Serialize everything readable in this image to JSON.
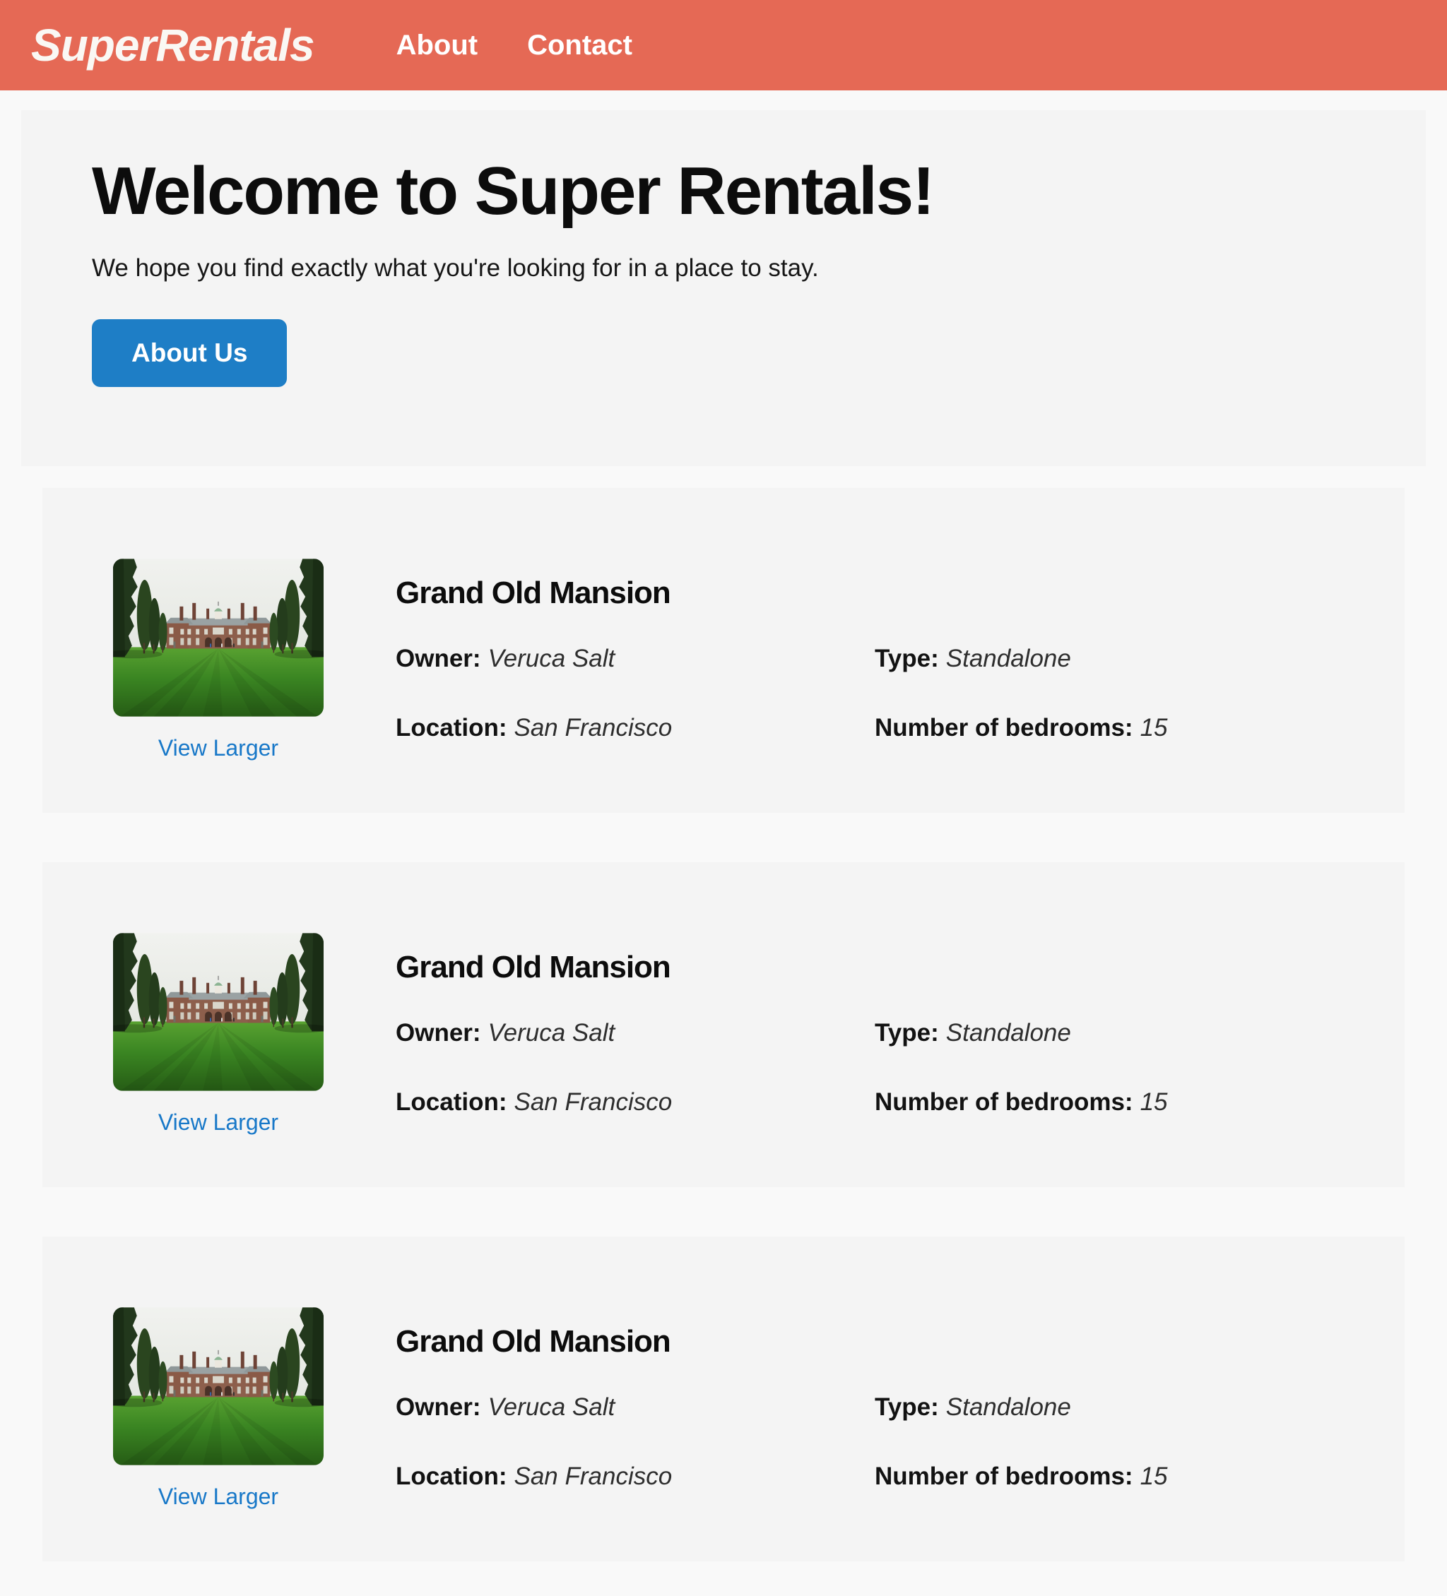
{
  "colors": {
    "navbar_bg": "#e56955",
    "button_bg": "#1e7ec6",
    "link_blue": "#1878c8",
    "section_bg": "#f4f4f4",
    "page_bg": "#f9f9f9"
  },
  "nav": {
    "brand": "SuperRentals",
    "links": [
      {
        "label": "About"
      },
      {
        "label": "Contact"
      }
    ]
  },
  "hero": {
    "title": "Welcome to Super Rentals!",
    "subtitle": "We hope you find exactly what you're looking for in a place to stay.",
    "button_label": "About Us"
  },
  "listings": [
    {
      "title": "Grand Old Mansion",
      "view_larger": "View Larger",
      "image_name": "grand-old-mansion-photo",
      "fields": {
        "owner_label": "Owner:",
        "owner": "Veruca Salt",
        "type_label": "Type:",
        "type": "Standalone",
        "location_label": "Location:",
        "location": "San Francisco",
        "bedrooms_label": "Number of bedrooms:",
        "bedrooms": "15"
      }
    },
    {
      "title": "Grand Old Mansion",
      "view_larger": "View Larger",
      "image_name": "grand-old-mansion-photo",
      "fields": {
        "owner_label": "Owner:",
        "owner": "Veruca Salt",
        "type_label": "Type:",
        "type": "Standalone",
        "location_label": "Location:",
        "location": "San Francisco",
        "bedrooms_label": "Number of bedrooms:",
        "bedrooms": "15"
      }
    },
    {
      "title": "Grand Old Mansion",
      "view_larger": "View Larger",
      "image_name": "grand-old-mansion-photo",
      "fields": {
        "owner_label": "Owner:",
        "owner": "Veruca Salt",
        "type_label": "Type:",
        "type": "Standalone",
        "location_label": "Location:",
        "location": "San Francisco",
        "bedrooms_label": "Number of bedrooms:",
        "bedrooms": "15"
      }
    }
  ]
}
